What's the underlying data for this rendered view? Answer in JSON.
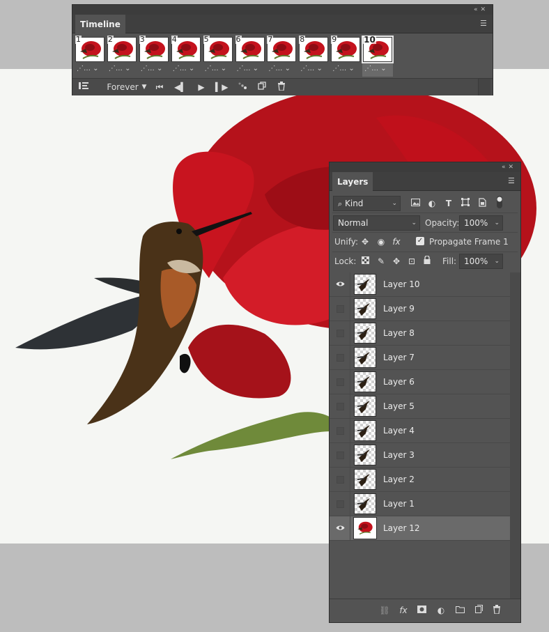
{
  "colors": {
    "panel": "#535353",
    "panel_dark": "#3f3f3f",
    "canvas": "#f5f6f3",
    "workspace": "#bdbdbd",
    "active_row": "#6a6a6a"
  },
  "timeline": {
    "tab_label": "Timeline",
    "frames": [
      {
        "num": "1",
        "selected": false
      },
      {
        "num": "2",
        "selected": false
      },
      {
        "num": "3",
        "selected": false
      },
      {
        "num": "4",
        "selected": false
      },
      {
        "num": "5",
        "selected": false
      },
      {
        "num": "6",
        "selected": false
      },
      {
        "num": "7",
        "selected": false
      },
      {
        "num": "8",
        "selected": false
      },
      {
        "num": "9",
        "selected": false
      },
      {
        "num": "10",
        "selected": true
      }
    ],
    "loop_value": "Forever",
    "icons": [
      "convert-to-video-timeline-icon",
      "first-frame-icon",
      "previous-frame-icon",
      "play-icon",
      "next-frame-icon",
      "tween-icon",
      "duplicate-frame-icon",
      "delete-frame-icon"
    ]
  },
  "layers_panel": {
    "tab_label": "Layers",
    "filter_kind": "Kind",
    "blend_mode": "Normal",
    "opacity_label": "Opacity:",
    "opacity_value": "100%",
    "unify_label": "Unify:",
    "propagate_label": "Propagate Frame 1",
    "propagate_checked": true,
    "lock_label": "Lock:",
    "fill_label": "Fill:",
    "fill_value": "100%",
    "layers": [
      {
        "name": "Layer 10",
        "visible": true,
        "active": false,
        "thumb": "transparent"
      },
      {
        "name": "Layer 9",
        "visible": false,
        "active": false,
        "thumb": "transparent"
      },
      {
        "name": "Layer 8",
        "visible": false,
        "active": false,
        "thumb": "transparent"
      },
      {
        "name": "Layer 7",
        "visible": false,
        "active": false,
        "thumb": "transparent"
      },
      {
        "name": "Layer 6",
        "visible": false,
        "active": false,
        "thumb": "transparent"
      },
      {
        "name": "Layer 5",
        "visible": false,
        "active": false,
        "thumb": "transparent"
      },
      {
        "name": "Layer 4",
        "visible": false,
        "active": false,
        "thumb": "transparent"
      },
      {
        "name": "Layer 3",
        "visible": false,
        "active": false,
        "thumb": "transparent"
      },
      {
        "name": "Layer 2",
        "visible": false,
        "active": false,
        "thumb": "transparent"
      },
      {
        "name": "Layer 1",
        "visible": false,
        "active": false,
        "thumb": "transparent"
      },
      {
        "name": "Layer 12",
        "visible": true,
        "active": true,
        "thumb": "rose"
      }
    ],
    "footer_icons": [
      "link-layers-icon",
      "fx-icon",
      "add-mask-icon",
      "adjustment-layer-icon",
      "new-group-icon",
      "new-layer-icon",
      "delete-layer-icon"
    ]
  }
}
